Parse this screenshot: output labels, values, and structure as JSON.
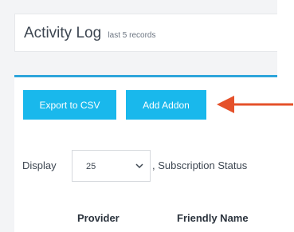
{
  "header": {
    "title": "Activity Log",
    "subtitle": "last 5 records"
  },
  "toolbar": {
    "export_label": "Export to CSV",
    "add_addon_label": "Add Addon"
  },
  "filters": {
    "display_label": "Display",
    "display_value": "25",
    "subscription_status_label": ", Subscription Status"
  },
  "table": {
    "columns": [
      "Provider",
      "Friendly Name"
    ]
  },
  "annotation": {
    "arrow_color": "#e5512a",
    "arrow_icon": "left-arrow-icon"
  },
  "colors": {
    "button": "#19b8ec",
    "accent_border": "#2ea5db"
  }
}
